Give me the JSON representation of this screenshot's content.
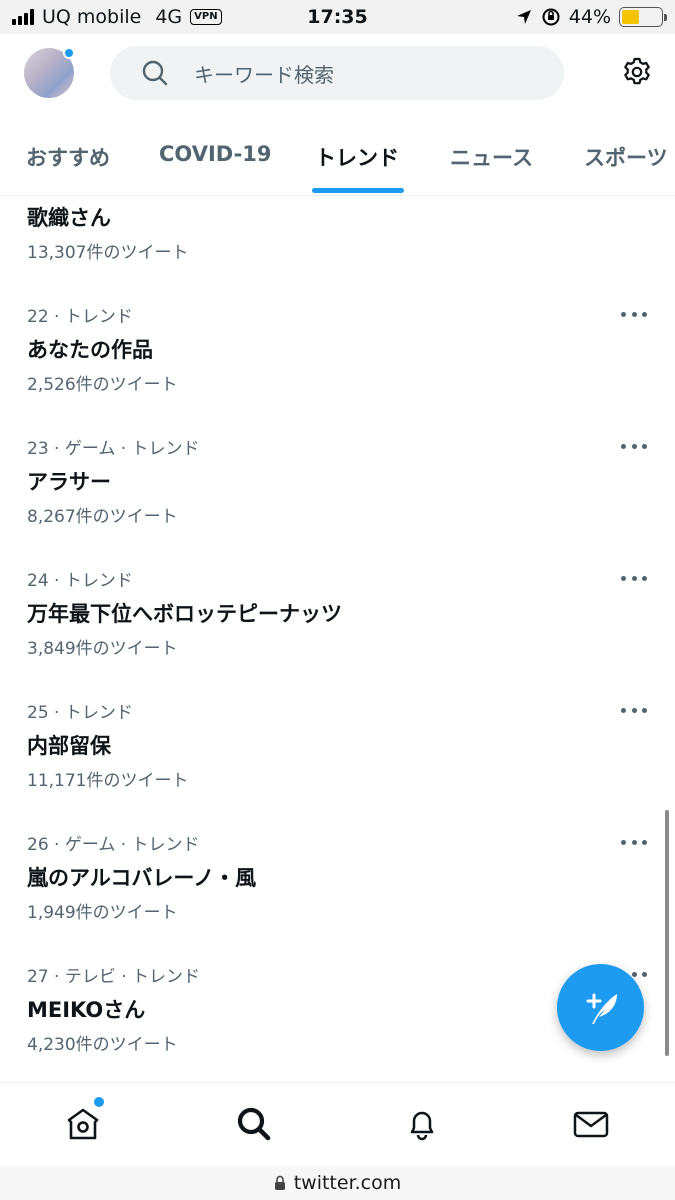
{
  "status_bar": {
    "carrier": "UQ mobile",
    "network": "4G",
    "vpn": "VPN",
    "time": "17:35",
    "battery": "44%",
    "battery_level": 0.44
  },
  "header": {
    "search_placeholder": "キーワード検索"
  },
  "tabs": [
    {
      "label": "おすすめ"
    },
    {
      "label": "COVID-19"
    },
    {
      "label": "トレンド",
      "active": true
    },
    {
      "label": "ニュース"
    },
    {
      "label": "スポーツ"
    }
  ],
  "trends": [
    {
      "meta": "",
      "name": "歌織さん",
      "count": "13,307件のツイート"
    },
    {
      "meta": "22 · トレンド",
      "name": "あなたの作品",
      "count": "2,526件のツイート"
    },
    {
      "meta": "23 · ゲーム · トレンド",
      "name": "アラサー",
      "count": "8,267件のツイート"
    },
    {
      "meta": "24 · トレンド",
      "name": "万年最下位へボロッテピーナッツ",
      "count": "3,849件のツイート"
    },
    {
      "meta": "25 · トレンド",
      "name": "内部留保",
      "count": "11,171件のツイート"
    },
    {
      "meta": "26 · ゲーム · トレンド",
      "name": "嵐のアルコバレーノ・風",
      "count": "1,949件のツイート"
    },
    {
      "meta": "27 · テレビ · トレンド",
      "name": "MEIKOさん",
      "count": "4,230件のツイート"
    }
  ],
  "bottom_nav": [
    {
      "icon": "home-icon"
    },
    {
      "icon": "search-icon"
    },
    {
      "icon": "bell-icon"
    },
    {
      "icon": "mail-icon"
    }
  ],
  "url_bar": {
    "domain": "twitter.com"
  },
  "colors": {
    "accent": "#1d9bf0",
    "text_primary": "#0f1419",
    "text_secondary": "#536471"
  }
}
